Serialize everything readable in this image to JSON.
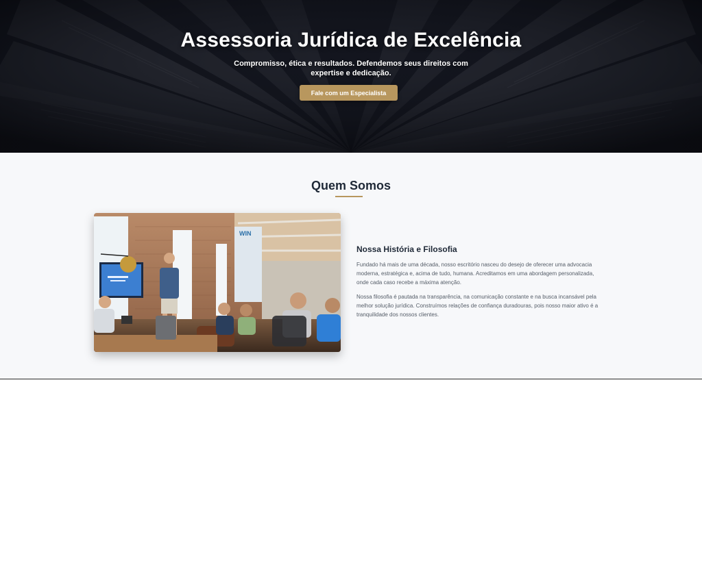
{
  "hero": {
    "title": "Assessoria Jurídica de Excelência",
    "subtitle": "Compromisso, ética e resultados. Defendemos seus direitos com expertise e dedicação.",
    "cta_label": "Fale com um Especialista",
    "background_image": "open-book-pages",
    "overlay_color": "#0d0f18"
  },
  "about": {
    "title": "Quem Somos",
    "accent_color": "#b8975e",
    "image": "team-meeting-photo",
    "heading": "Nossa História e Filosofia",
    "paragraph_1": "Fundado há mais de uma década, nosso escritório nasceu do desejo de oferecer uma advocacia moderna, estratégica e, acima de tudo, humana. Acreditamos em uma abordagem personalizada, onde cada caso recebe a máxima atenção.",
    "paragraph_2": "Nossa filosofia é pautada na transparência, na comunicação constante e na busca incansável pela melhor solução jurídica. Construímos relações de confiança duradouras, pois nosso maior ativo é a tranquilidade dos nossos clientes."
  },
  "colors": {
    "accent": "#b8975e",
    "section_bg": "#f7f8fa",
    "text_dark": "#1f2937",
    "text_muted": "#555d68"
  }
}
